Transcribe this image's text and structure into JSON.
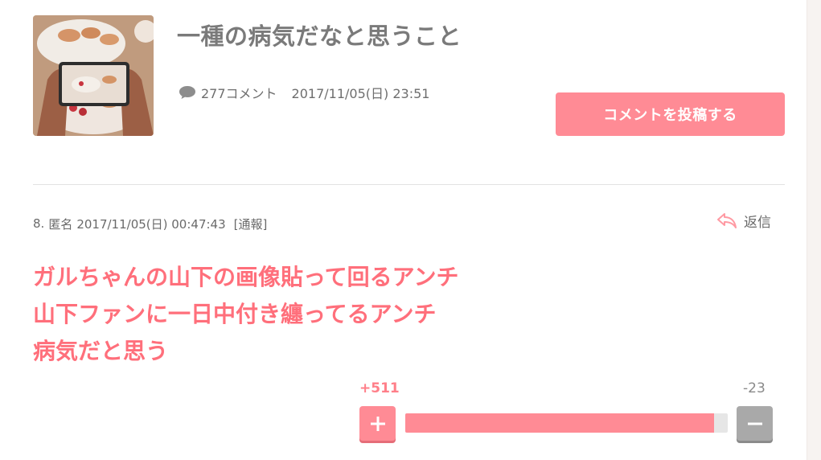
{
  "header": {
    "title": "一種の病気だなと思うこと",
    "comment_count": "277コメント",
    "date": "2017/11/05(日) 23:51",
    "post_button_label": "コメントを投稿する",
    "thumbnail_icon": "photo-thumbnail-icon",
    "comment_icon": "speech-bubble-icon"
  },
  "comment": {
    "number": "8.",
    "author": "匿名",
    "timestamp": "2017/11/05(日) 00:47:43",
    "report_label": "[通報]",
    "reply_label": "返信",
    "reply_icon": "reply-arrow-icon",
    "body_lines": [
      "ガルちゃんの山下の画像貼って回るアンチ",
      "山下ファンに一日中付き纏ってるアンチ",
      "病気だと思う"
    ]
  },
  "vote": {
    "plus": "+511",
    "minus": "-23",
    "plus_ratio": 0.957,
    "plus_icon": "plus-icon",
    "minus_icon": "minus-icon"
  },
  "colors": {
    "accent": "#ff8b95",
    "comment_text": "#ff6f7b",
    "title_text": "#7a7a7a",
    "minus_button": "#a9a9a9"
  }
}
